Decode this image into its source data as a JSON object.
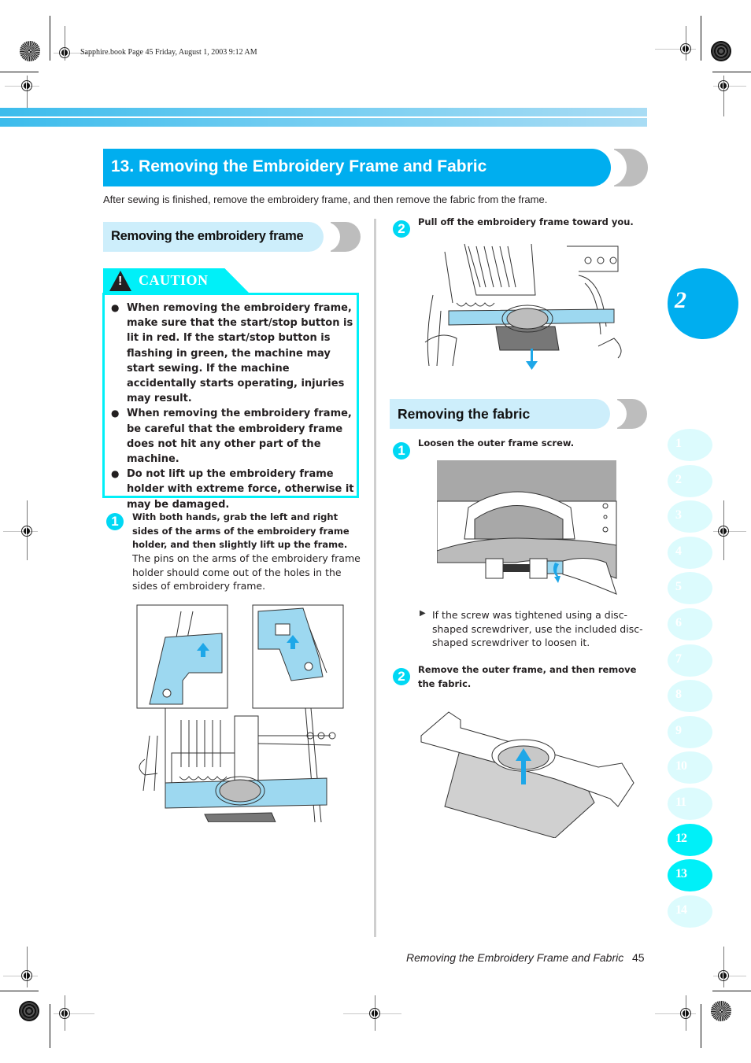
{
  "print_header": "Sapphire.book  Page 45  Friday, August 1, 2003  9:12 AM",
  "page_title": "13. Removing the Embroidery Frame and Fabric",
  "intro": "After sewing is finished, remove the embroidery frame, and then remove the fabric from the frame.",
  "section_left": {
    "heading": "Removing the embroidery frame",
    "caution": {
      "label": "CAUTION",
      "icon": "warning-triangle-icon",
      "items": [
        "When removing the embroidery frame, make sure that the start/stop button is lit in red. If the start/stop button is flashing in green, the machine may start sewing. If the machine accidentally starts operating, injuries may result.",
        "When removing the embroidery frame, be careful that the embroidery frame does not hit any other part of the machine.",
        "Do not lift up the embroidery frame holder with extreme force, otherwise it may be damaged."
      ]
    },
    "steps": [
      {
        "number": "1",
        "instruction": "With both hands, grab the left and right sides of the arms of the embroidery frame holder, and then slightly lift up the frame.",
        "detail": "The pins on the arms of the embroidery frame holder should come out of the holes in the sides of embroidery frame."
      }
    ]
  },
  "section_right": {
    "step_top": {
      "number": "2",
      "instruction": "Pull off the embroidery frame toward you."
    },
    "heading": "Removing the fabric",
    "steps": [
      {
        "number": "1",
        "instruction": "Loosen the outer frame screw.",
        "note": "If the screw was tightened using a disc-shaped screwdriver, use the included disc-shaped screwdriver to loosen it."
      },
      {
        "number": "2",
        "instruction": "Remove the outer frame, and then remove the fabric."
      }
    ]
  },
  "chapter": {
    "number": "2",
    "tabs": [
      "1",
      "2",
      "3",
      "4",
      "5",
      "6",
      "7",
      "8",
      "9",
      "10",
      "11",
      "12",
      "13",
      "14"
    ],
    "active_tabs": [
      "12",
      "13"
    ]
  },
  "footer": {
    "title": "Removing the Embroidery Frame and Fabric",
    "page_number": "45"
  },
  "colors": {
    "primary_blue": "#00aeef",
    "caution_cyan": "#00f0f8",
    "subheading_bg": "#cdeefb",
    "illustration_blue": "#9dd8f0",
    "arrow_blue": "#1ea7e8"
  }
}
